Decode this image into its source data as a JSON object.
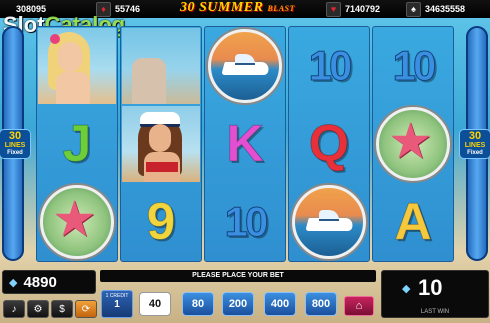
{
  "top_bar": {
    "jackpots": [
      {
        "suit": "♥",
        "value": "308095"
      },
      {
        "suit": "♦",
        "value": "55746"
      },
      {
        "suit": "♥",
        "value": "7140792"
      },
      {
        "suit": "♠",
        "value": "34635558"
      }
    ],
    "game_title": "30 SUMMER",
    "game_title_suffix": "BLAST",
    "watermark_main": "Slot",
    "watermark_accent": "Catalog"
  },
  "side_badges": {
    "left": {
      "number": "30",
      "text": "LINES",
      "sub": "Fixed"
    },
    "right": {
      "number": "30",
      "text": "LINES",
      "sub": "Fixed"
    }
  },
  "reels": [
    [
      {
        "type": "portrait-blonde"
      },
      {
        "type": "letter",
        "text": "J",
        "color": "#6ccf3a"
      },
      {
        "type": "starfish"
      }
    ],
    [
      {
        "type": "portrait-blonde-partial"
      },
      {
        "type": "portrait-captain"
      },
      {
        "type": "letter",
        "text": "9",
        "color": "#f2d53c"
      }
    ],
    [
      {
        "type": "boat"
      },
      {
        "type": "letter",
        "text": "K",
        "color": "#e24fd0"
      },
      {
        "type": "ten",
        "text": "10"
      }
    ],
    [
      {
        "type": "ten",
        "text": "10"
      },
      {
        "type": "letter",
        "text": "Q",
        "color": "#e8303a"
      },
      {
        "type": "boat"
      }
    ],
    [
      {
        "type": "ten",
        "text": "10"
      },
      {
        "type": "starfish"
      },
      {
        "type": "letter",
        "text": "A",
        "color": "#f6c93d"
      }
    ]
  ],
  "bottom": {
    "balance": "4890",
    "message": "PLEASE PLACE YOUR BET",
    "credit_label": "1 CREDIT",
    "credit_value": "1",
    "bet_options": [
      "40",
      "80",
      "200",
      "400",
      "800"
    ],
    "selected_bet": "40",
    "last_win": "10",
    "last_win_label": "LAST WIN"
  }
}
